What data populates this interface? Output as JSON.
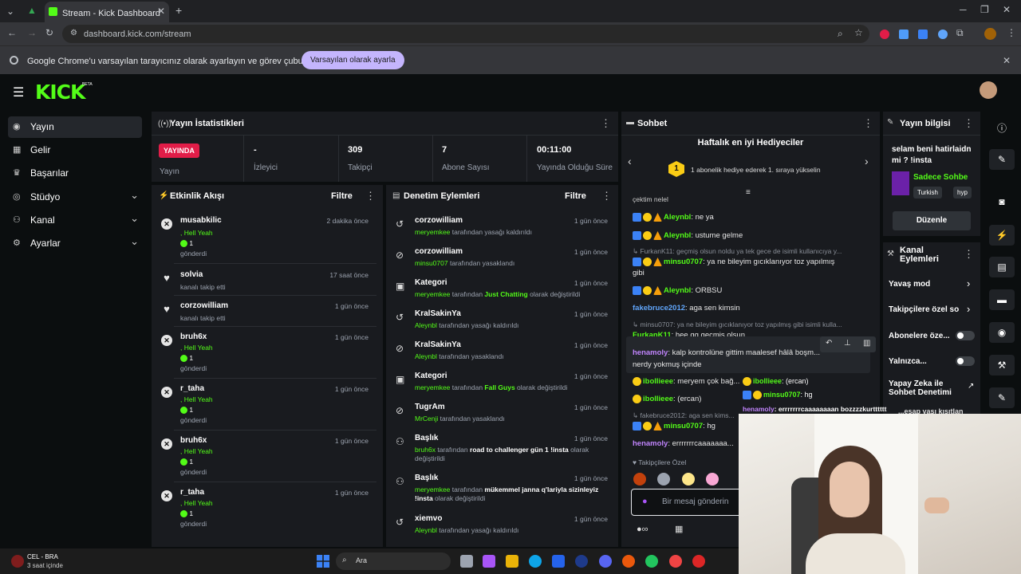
{
  "browser": {
    "tab_title": "Stream - Kick Dashboard",
    "url": "dashboard.kick.com/stream",
    "infobar_text": "Google Chrome'u varsayılan tarayıcınız olarak ayarlayın ve görev çubuğunuza sabitleyin",
    "infobar_button": "Varsayılan olarak ayarla"
  },
  "header": {
    "logo": "KICK",
    "logo_badge": "BETA"
  },
  "sidebar": {
    "items": [
      {
        "label": "Yayın",
        "icon": "broadcast-icon"
      },
      {
        "label": "Gelir",
        "icon": "chart-icon"
      },
      {
        "label": "Başarılar",
        "icon": "trophy-icon"
      },
      {
        "label": "Stüdyo",
        "icon": "studio-icon"
      },
      {
        "label": "Kanal",
        "icon": "users-icon"
      },
      {
        "label": "Ayarlar",
        "icon": "gear-icon"
      }
    ]
  },
  "stats": {
    "title": "Yayın İstatistikleri",
    "live_badge": "YAYINDA",
    "live_label": "Yayın",
    "viewers_value": "-",
    "viewers_label": "İzleyici",
    "followers_value": "309",
    "followers_label": "Takipçi",
    "subs_value": "7",
    "subs_label": "Abone Sayısı",
    "duration_value": "00:11:00",
    "duration_label": "Yayında Olduğu Süre"
  },
  "activity": {
    "title": "Etkinlik Akışı",
    "filter": "Filtre",
    "items": [
      {
        "name": "musabkilic",
        "time": "2 dakika önce",
        "line1": ", Hell Yeah",
        "count": "1",
        "line3": "gönderdi"
      },
      {
        "name": "solvia",
        "time": "17 saat önce",
        "line1": "kanalı takip etti"
      },
      {
        "name": "corzowilliam",
        "time": "1 gün önce",
        "line1": "kanalı takip etti"
      },
      {
        "name": "bruh6x",
        "time": "1 gün önce",
        "line1": ", Hell Yeah",
        "count": "1",
        "line3": "gönderdi"
      },
      {
        "name": "r_taha",
        "time": "1 gün önce",
        "line1": ", Hell Yeah",
        "count": "1",
        "line3": "gönderdi"
      },
      {
        "name": "bruh6x",
        "time": "1 gün önce",
        "line1": ", Hell Yeah",
        "count": "1",
        "line3": "gönderdi"
      },
      {
        "name": "r_taha",
        "time": "1 gün önce",
        "line1": ", Hell Yeah",
        "count": "1",
        "line3": "gönderdi"
      }
    ]
  },
  "moderation": {
    "title": "Denetim Eylemleri",
    "filter": "Filtre",
    "items": [
      {
        "name": "corzowilliam",
        "time": "1 gün önce",
        "actor": "meryemkee",
        "text": " tarafından yasağı kaldırıldı"
      },
      {
        "name": "corzowilliam",
        "time": "1 gün önce",
        "actor": "minsu0707",
        "text": " tarafından yasaklandı"
      },
      {
        "name": "Kategori",
        "time": "1 gün önce",
        "actor": "meryemkee",
        "text": " tarafından ",
        "bold": "Just Chatting",
        "text2": " olarak değiştirildi"
      },
      {
        "name": "KralSakinYa",
        "time": "1 gün önce",
        "actor": "Aleynbl",
        "text": " tarafından yasağı kaldırıldı"
      },
      {
        "name": "KralSakinYa",
        "time": "1 gün önce",
        "actor": "Aleynbl",
        "text": " tarafından yasaklandı"
      },
      {
        "name": "Kategori",
        "time": "1 gün önce",
        "actor": "meryemkee",
        "text": " tarafından ",
        "bold": "Fall Guys",
        "text2": " olarak değiştirildi"
      },
      {
        "name": "TugrAm",
        "time": "1 gün önce",
        "actor": "MrCenji",
        "text": " tarafından yasaklandı"
      },
      {
        "name": "Başlık",
        "time": "1 gün önce",
        "actor": "bruh6x",
        "text": " tarafından ",
        "bold": "road to challenger gün 1 !insta",
        "text2": " olarak değiştirildi"
      },
      {
        "name": "Başlık",
        "time": "1 gün önce",
        "actor": "meryemkee",
        "text": " tarafından ",
        "bold": "mükemmel janna q'lariyla sizinleyiz !insta",
        "text2": " olarak değiştirildi"
      },
      {
        "name": "xiemvo",
        "time": "1 gün önce",
        "actor": "Aleynbl",
        "text": " tarafından yasağı kaldırıldı"
      }
    ]
  },
  "chat": {
    "title": "Sohbet",
    "gifters_title": "Haftalık en iyi Hediyeciler",
    "gifters_rank": "1",
    "gifters_text": "1 abonelik hediye ederek 1. sıraya yükselin",
    "cut_line": "çektim nelel",
    "followers_only": "Takipçilere Özel",
    "input_placeholder": "Bir mesaj gönderin",
    "messages": [
      {
        "user": "Aleynbl",
        "text": ": ne ya"
      },
      {
        "user": "Aleynbl",
        "text": ": ustume gelme"
      },
      {
        "reply": "FurkanK11: geçmiş olsun noldu ya tek gece de isimli kullanıcıya y..."
      },
      {
        "user": "minsu0707",
        "text": ": ya ne bileyim gıcıklanıyor toz yapılmış",
        "cont": "gibi"
      },
      {
        "user": "Aleynbl",
        "text": ": ORBSU"
      },
      {
        "user": "fakebruce2012",
        "text": ": aga sen kimsin"
      },
      {
        "reply": "minsu0707: ya ne bileyim gıcıklanıyor toz yapılmış gibi isimli kulla..."
      },
      {
        "user": "FurkanK11",
        "text": ": hee gg gecmis olsun..."
      },
      {
        "user": "henamoly",
        "text": ": kalp kontrolüne gittim maalesef hâlâ boşm...",
        "cont": "nerdy yokmuş içinde"
      },
      {
        "user": "ibollieee",
        "text": ": meryem çok bağ..."
      },
      {
        "user": "ibollieee",
        "text": ": (ercan)"
      },
      {
        "reply": "fakebruce2012: aga sen kims..."
      },
      {
        "user": "minsu0707",
        "text": ": hg"
      },
      {
        "user": "henamoly",
        "text": ": errrrrrrcaaaaaaa..."
      }
    ],
    "overlay": [
      {
        "user": "ibollieee",
        "text": ": (ercan)"
      },
      {
        "user": "minsu0707",
        "text": ": hg"
      },
      {
        "user": "henamoly",
        "text": ": errrrrrrcaaaaaaaan bozzzzkurtttttt"
      },
      {
        "text": "...esap yaşı kısıtlan"
      }
    ]
  },
  "stream_info": {
    "title": "Yayın bilgisi",
    "stream_title": "selam beni hatirlaidn mi ? !insta",
    "category": "Sadece Sohbe",
    "tags": [
      "Turkish",
      "hyp"
    ],
    "edit_button": "Düzenle"
  },
  "channel_actions": {
    "title": "Kanal Eylemleri",
    "items": [
      {
        "label": "Yavaş mod",
        "kind": "chevron"
      },
      {
        "label": "Takipçilere özel so",
        "kind": "chevron"
      },
      {
        "label": "Abonelere öze...",
        "kind": "toggle"
      },
      {
        "label": "Yalnızca...",
        "kind": "toggle"
      },
      {
        "label": "Yapay Zeka ile Sohbet Denetimi",
        "kind": "external"
      }
    ]
  },
  "taskbar": {
    "weather_line1": "CEL - BRA",
    "weather_line2": "3 saat içinde",
    "search": "Ara"
  },
  "colors": {
    "brand": "#53fc18",
    "live": "#e11d48",
    "panel": "#191b1f",
    "page": "#0b0e0f"
  }
}
